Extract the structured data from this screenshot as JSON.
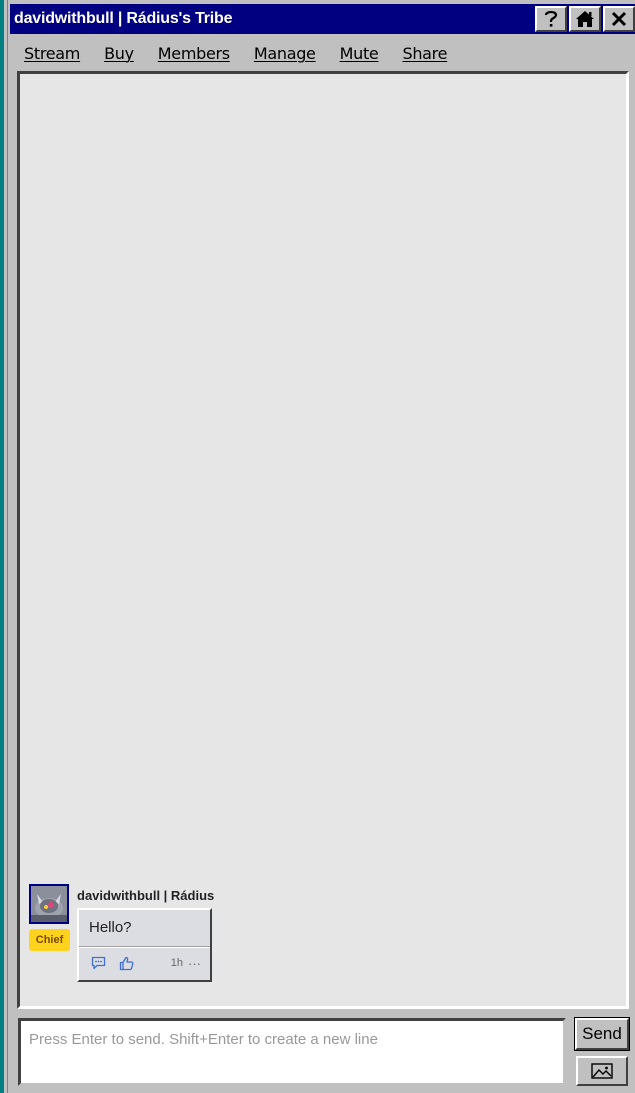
{
  "window": {
    "title": "davidwithbull | Rádius's Tribe",
    "buttons": [
      "help-icon",
      "home-icon",
      "close-icon"
    ]
  },
  "menu": {
    "items": [
      "Stream",
      "Buy",
      "Members",
      "Manage",
      "Mute",
      "Share"
    ]
  },
  "post": {
    "author": "davidwithbull | Rádius",
    "badge": "Chief",
    "text": "Hello?",
    "time": "1h",
    "more": "···",
    "icons": [
      "comment-icon",
      "like-icon"
    ]
  },
  "composer": {
    "placeholder": "Press Enter to send. Shift+Enter to create a new line",
    "value": "",
    "send_label": "Send",
    "image_button_icon": "image-icon"
  },
  "colors": {
    "titlebar": "#000080",
    "chrome": "#c0c0c0",
    "stream_bg": "#e6e6e6",
    "badge": "#ffd21e",
    "action_icons": "#3d6fd6"
  }
}
